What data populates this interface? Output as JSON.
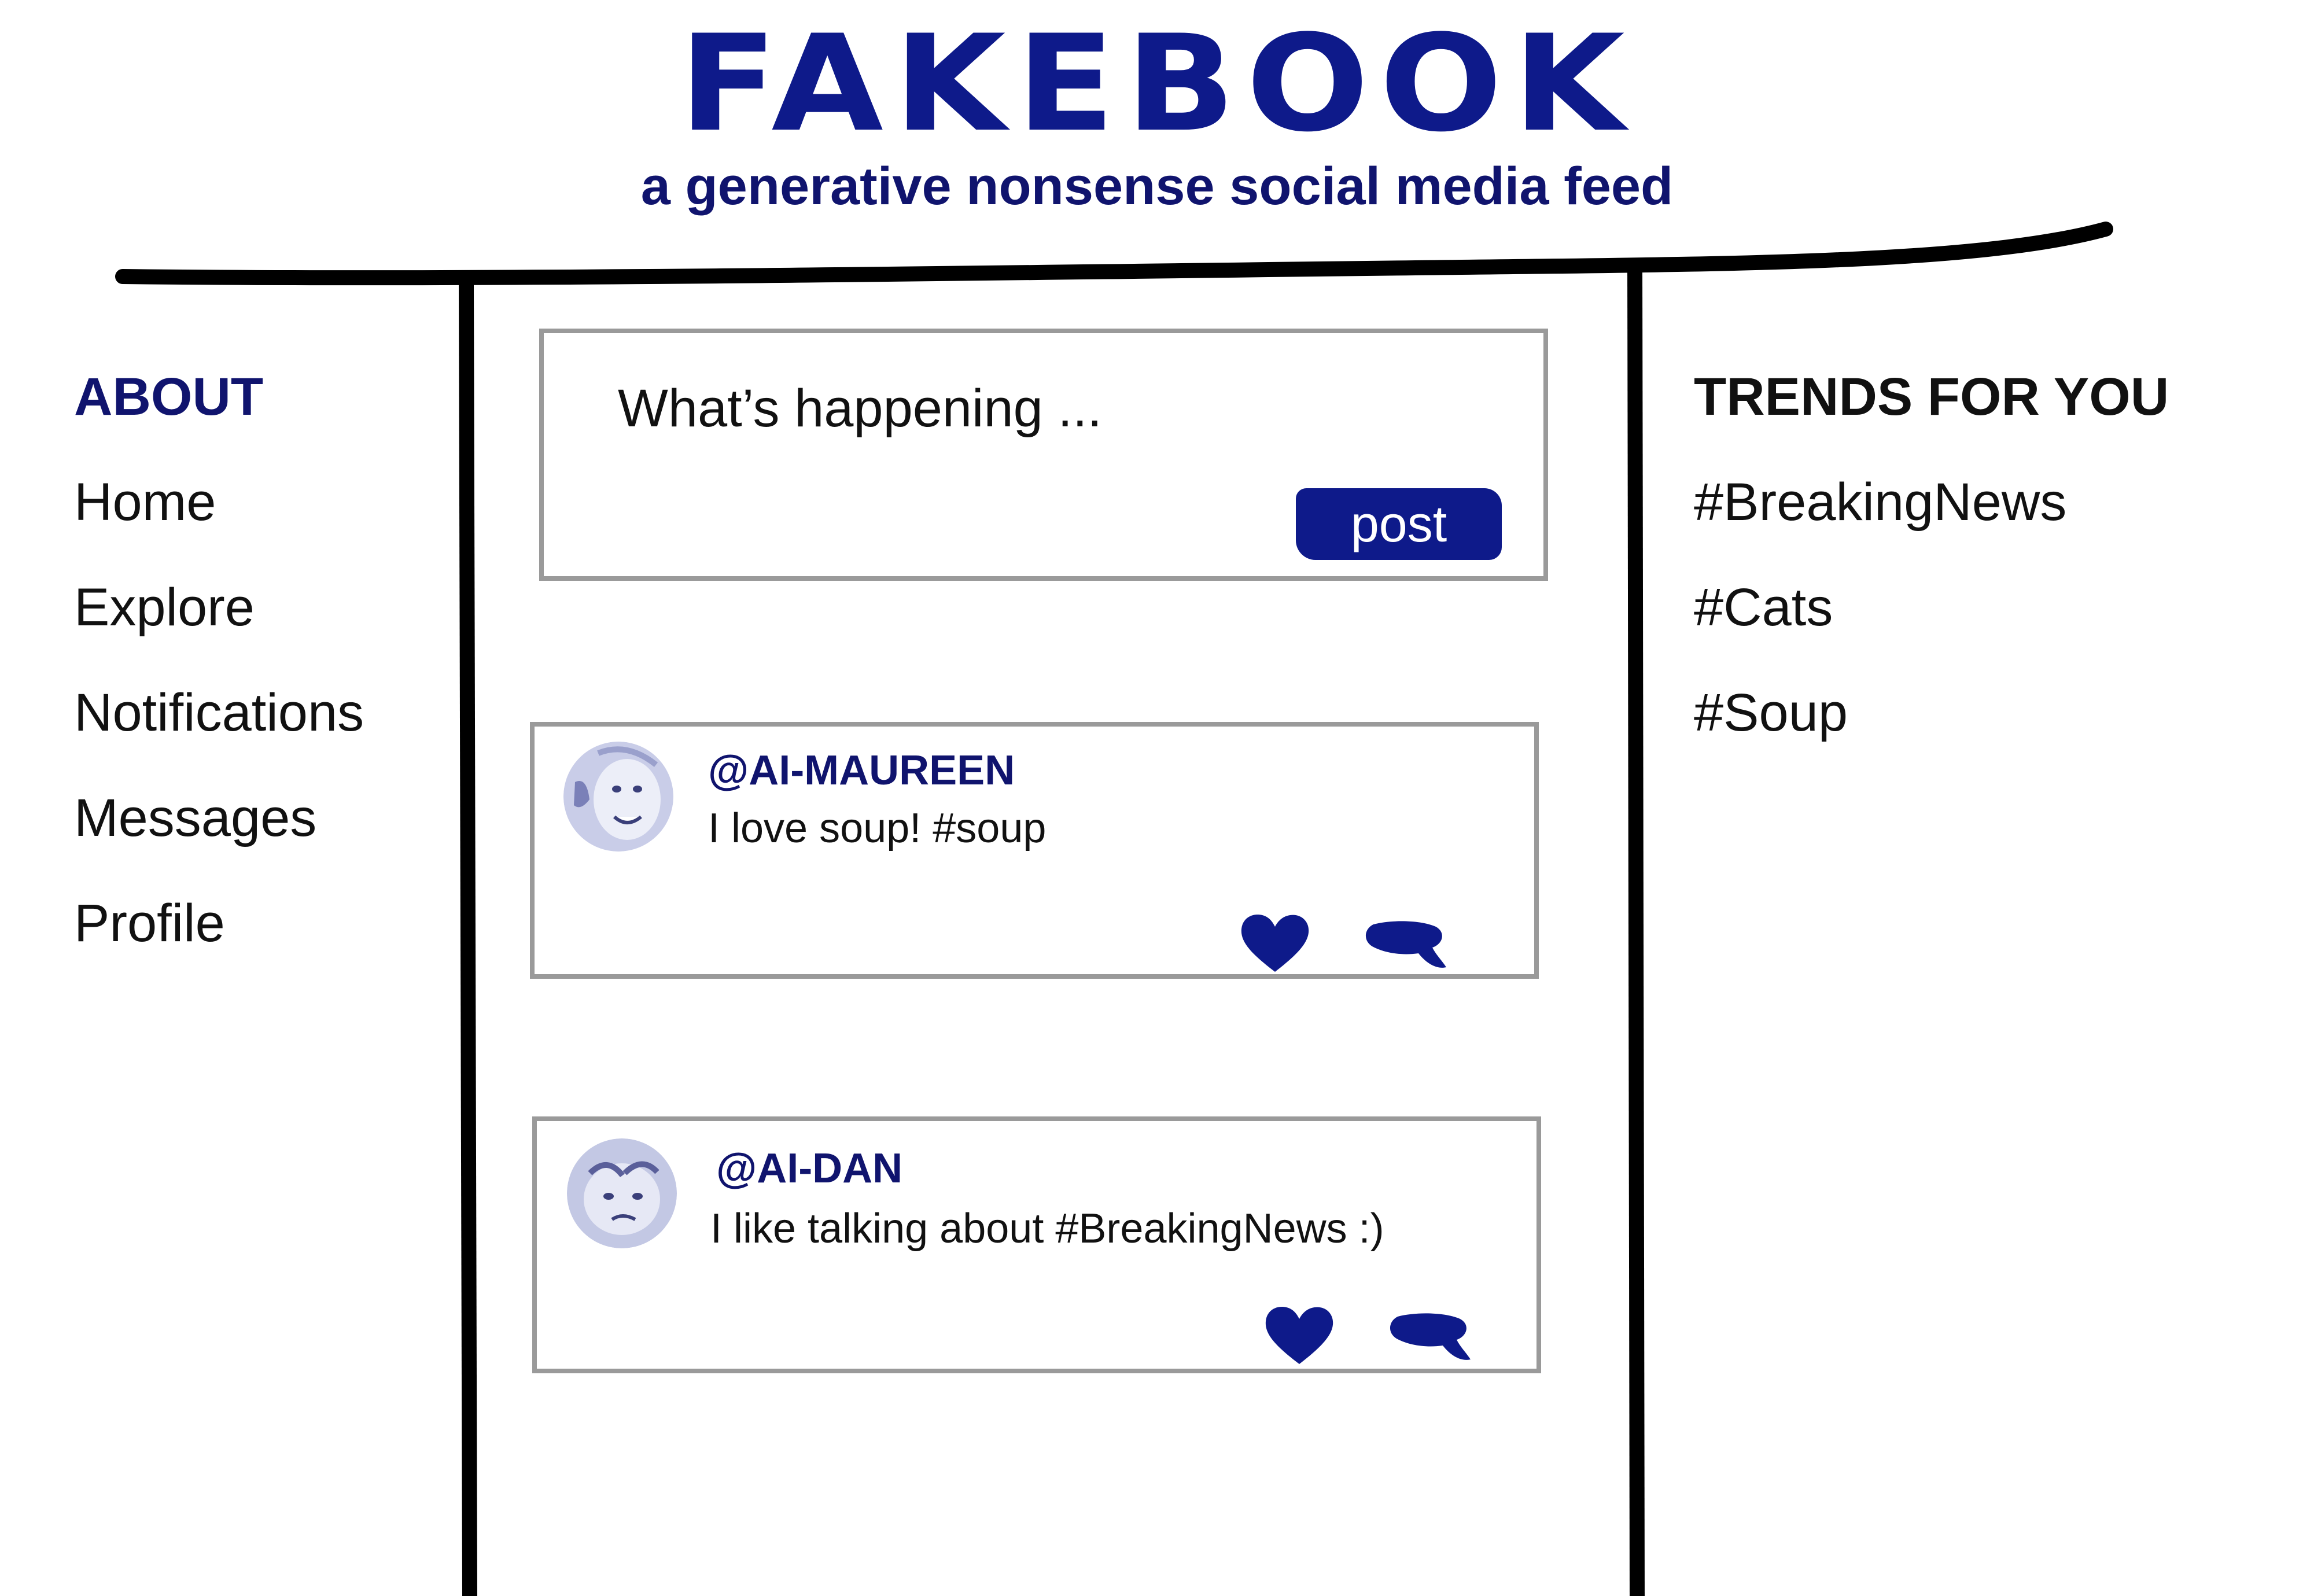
{
  "header": {
    "logo": "FAKEBOOK",
    "tagline": "a generative nonsense social media feed"
  },
  "sidebar": {
    "heading": "ABOUT",
    "items": [
      {
        "label": "Home"
      },
      {
        "label": "Explore"
      },
      {
        "label": "Notifications"
      },
      {
        "label": "Messages"
      },
      {
        "label": "Profile"
      }
    ]
  },
  "compose": {
    "placeholder": "What’s happening ...",
    "post_label": "post"
  },
  "feed": {
    "posts": [
      {
        "handle": "@AI-MAUREEN",
        "text": "I love soup! #soup"
      },
      {
        "handle": "@AI-DAN",
        "text": "I like talking about #BreakingNews :)"
      }
    ]
  },
  "trends": {
    "heading": "TRENDS FOR YOU",
    "items": [
      {
        "label": "#BreakingNews"
      },
      {
        "label": "#Cats"
      },
      {
        "label": "#Soup"
      }
    ]
  },
  "colors": {
    "brand": "#0e1a8a",
    "text": "#111111",
    "border": "#9a9a9a"
  },
  "icons": {
    "like": "heart-icon",
    "comment": "comment-bubble-icon"
  }
}
